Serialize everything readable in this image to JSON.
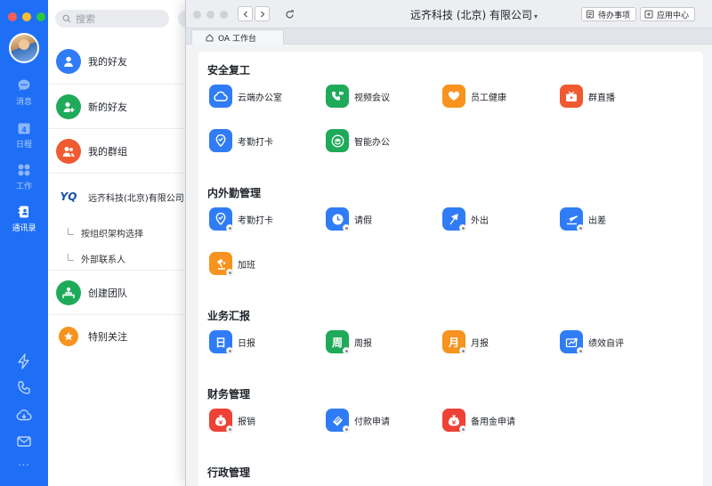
{
  "rail": {
    "nav": [
      {
        "label": "消息",
        "icon": "chat-bubble-icon"
      },
      {
        "label": "日程",
        "icon": "calendar-icon",
        "badge": "4"
      },
      {
        "label": "工作",
        "icon": "grid-icon"
      },
      {
        "label": "通讯录",
        "icon": "contacts-icon",
        "active": true
      }
    ],
    "more": "···"
  },
  "contacts": {
    "search_placeholder": "搜索",
    "items": [
      {
        "label": "我的好友"
      },
      {
        "label": "新的好友"
      },
      {
        "label": "我的群组"
      },
      {
        "label": "远齐科技(北京)有限公司",
        "logo": "YQ"
      },
      {
        "label": "创建团队"
      },
      {
        "label": "特别关注"
      }
    ],
    "sub_items": [
      "按组织架构选择",
      "外部联系人"
    ]
  },
  "window": {
    "title": "远齐科技 (北京) 有限公司",
    "title_caret": "▾",
    "todo_label": "待办事项",
    "app_center_label": "应用中心",
    "tab_label": "OA 工作台"
  },
  "sections": [
    {
      "title": "安全复工",
      "apps": [
        "云端办公室",
        "视频会议",
        "员工健康",
        "群直播",
        "考勤打卡",
        "智能办公"
      ]
    },
    {
      "title": "内外勤管理",
      "apps": [
        "考勤打卡",
        "请假",
        "外出",
        "出差",
        "加班"
      ]
    },
    {
      "title": "业务汇报",
      "apps": [
        "日报",
        "周报",
        "月报",
        "绩效自评"
      ],
      "glyphs": [
        "日",
        "周",
        "月",
        ""
      ]
    },
    {
      "title": "财务管理",
      "apps": [
        "报销",
        "付款申请",
        "备用金申请"
      ]
    },
    {
      "title": "行政管理",
      "apps": []
    }
  ],
  "colors": {
    "rail": "#1e6ff5",
    "blue": "#2f7cf6",
    "green": "#1faa5a",
    "orange": "#f7931e",
    "red": "#ef4136"
  }
}
